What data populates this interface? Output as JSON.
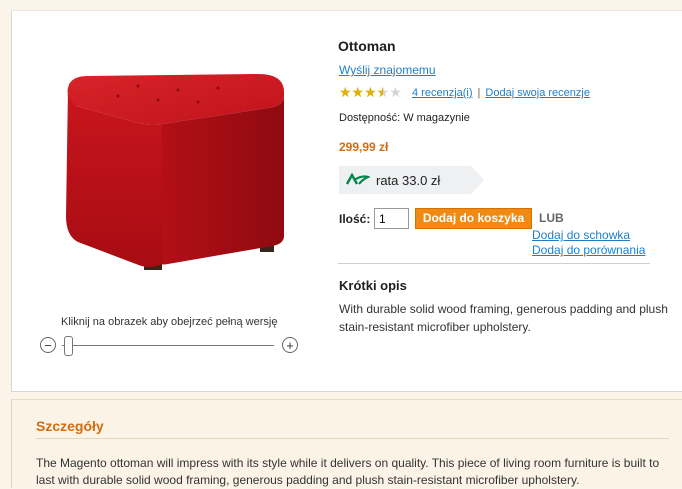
{
  "product": {
    "name": "Ottoman",
    "send_to_friend": "Wyślij znajomemu",
    "rating": {
      "stars_out_of_5": 3.5,
      "reviews_link": "4 recenzja(i)",
      "separator": "|",
      "add_review_link": "Dodaj swoja recenzje"
    },
    "availability": "Dostępność: W magazynie",
    "price": "299,99 zł",
    "installment": "rata 33.0 zł",
    "quantity_label": "Ilość:",
    "quantity_value": "1",
    "add_to_cart": "Dodaj do koszyka",
    "or_label": "LUB",
    "add_to_wishlist": "Dodaj do schowka",
    "add_to_compare": "Dodaj do porównania",
    "short_description_title": "Krótki opis",
    "short_description": "With durable solid wood framing, generous padding and plush stain-resistant microfiber upholstery."
  },
  "image_viewer": {
    "zoom_caption": "Kliknij na obrazek aby obejrzeć pełną wersję",
    "zoom_minus": "−",
    "zoom_plus": "+",
    "zoom_level": 0
  },
  "details": {
    "title": "Szczegóły",
    "text": "The Magento ottoman will impress with its style while it delivers on quality. This piece of living room furniture is built to last with durable solid wood framing, generous padding and plush stain-resistant microfiber upholstery."
  },
  "colors": {
    "accent_orange": "#f08a12",
    "link_blue": "#1e7ec8",
    "price_orange": "#d06d14",
    "ottoman_red": "#c8141e",
    "installment_green": "#00864a"
  },
  "icons": [
    "credit-agricole-logo-icon",
    "star-icon",
    "zoom-minus-icon",
    "zoom-plus-icon"
  ]
}
